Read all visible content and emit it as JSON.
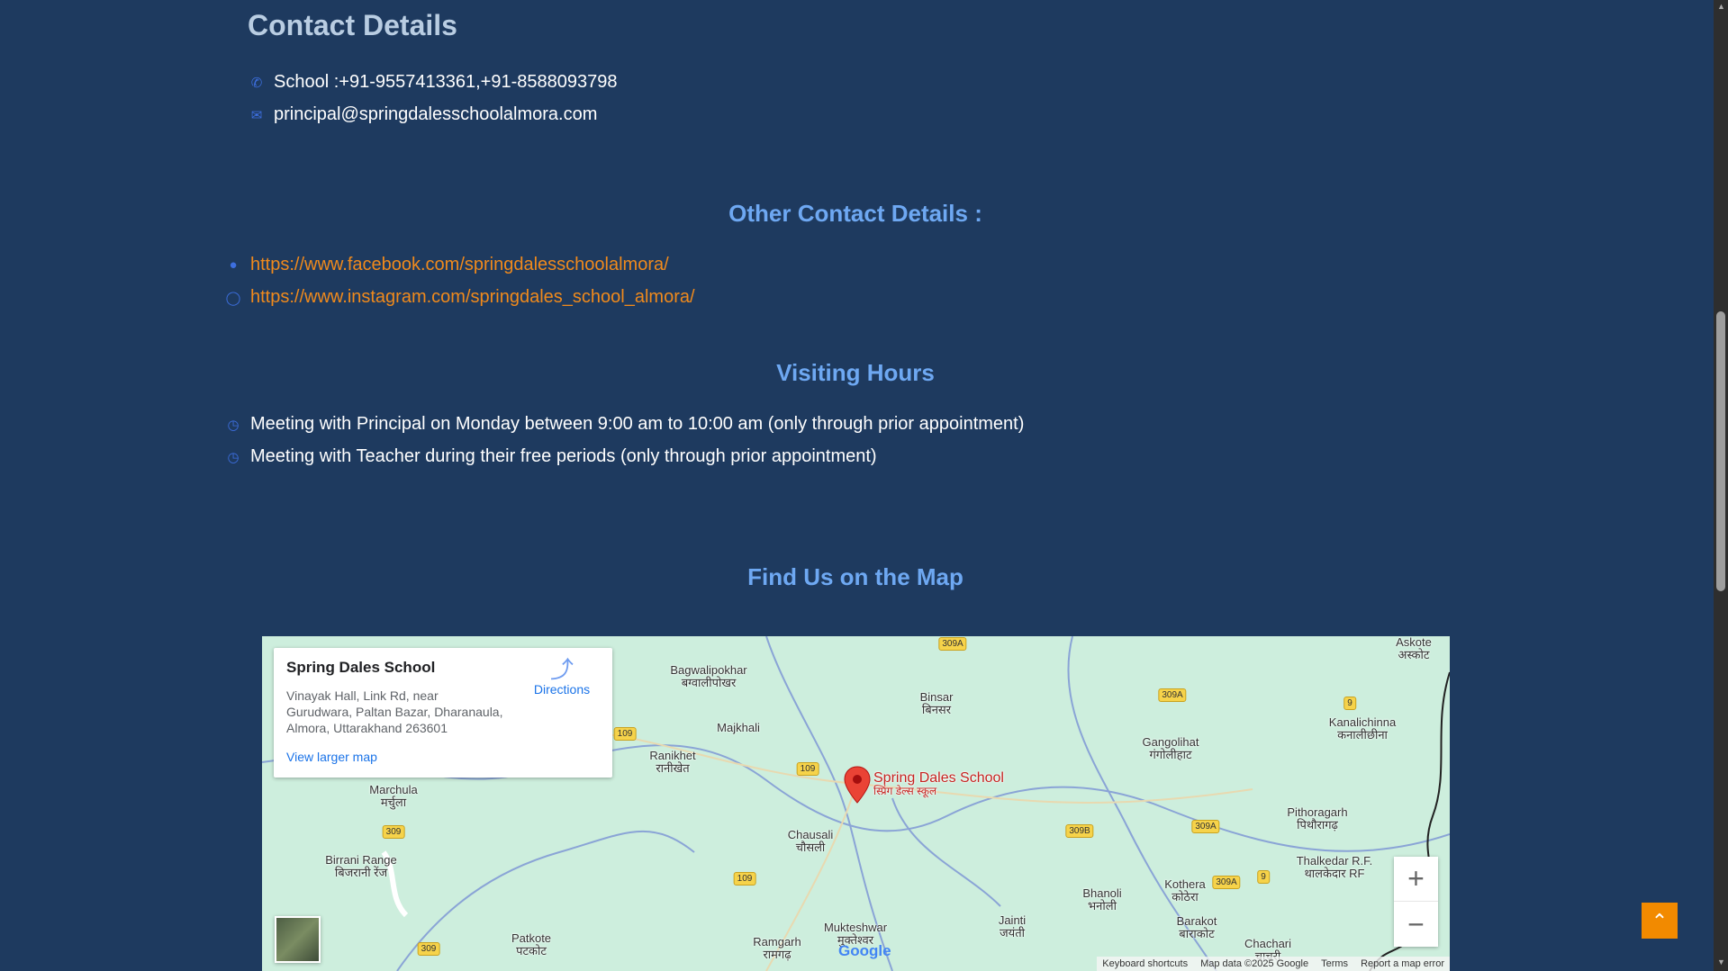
{
  "contact": {
    "title": "Contact Details",
    "phone": "School :+91-9557413361,+91-8588093798",
    "email": "principal@springdalesschoolalmora.com"
  },
  "other": {
    "title": "Other Contact Details :",
    "facebook": "https://www.facebook.com/springdalesschoolalmora/",
    "instagram": "https://www.instagram.com/springdales_school_almora/"
  },
  "visiting": {
    "title": "Visiting Hours",
    "items": [
      "Meeting with Principal on Monday between 9:00 am to 10:00 am (only through prior appointment)",
      "Meeting with Teacher during their free periods (only through prior appointment)"
    ]
  },
  "map": {
    "title": "Find Us on the Map",
    "place_name": "Spring Dales School",
    "address_lines": [
      "Vinayak Hall, Link Rd, near",
      "Gurudwara, Paltan Bazar, Dharanaula,",
      "Almora, Uttarakhand 263601"
    ],
    "directions": "Directions",
    "view_larger": "View larger map",
    "marker_label": "Spring Dales School",
    "marker_label_hi": "स्प्रिंग डेल्स स्कूल",
    "zoom_in": "+",
    "zoom_out": "−",
    "google": "Google",
    "attribution": [
      "Keyboard shortcuts",
      "Map data ©2025 Google",
      "Terms",
      "Report a map error"
    ],
    "places": [
      [
        "Bagwalipokhar",
        "बग्वालीपोखर"
      ],
      [
        "Binsar",
        "बिनसर"
      ],
      [
        "Majkhali",
        ""
      ],
      [
        "Ranikhet",
        "रानीखेत"
      ],
      [
        "Gangolihat",
        "गंगोलीहाट"
      ],
      [
        "Kanalichinna",
        "कनालीछीना"
      ],
      [
        "Marchula",
        "मर्चुला"
      ],
      [
        "Chausali",
        "चौसली"
      ],
      [
        "Pithoragarh",
        "पिथौरागढ़"
      ],
      [
        "Birrani Range",
        "बिजरानी रेंज"
      ],
      [
        "Thalkedar R.F.",
        "थालकेदार RF"
      ],
      [
        "Bhanoli",
        "भनोली"
      ],
      [
        "Kothera",
        "कोठेरा"
      ],
      [
        "Barakot",
        "बाराकोट"
      ],
      [
        "Jainti",
        "जयंती"
      ],
      [
        "Mukteshwar",
        "मुक्तेश्वर"
      ],
      [
        "Ramgarh",
        "रामगढ़"
      ],
      [
        "Patkote",
        "पटकोट"
      ],
      [
        "Chachari",
        "चाचरी"
      ],
      [
        "Askote",
        "अस्कोट"
      ]
    ],
    "roads": [
      "309A",
      "109",
      "109",
      "309A",
      "9",
      "309",
      "309B",
      "309A",
      "309A",
      "9",
      "109",
      "309"
    ]
  },
  "colors": {
    "background": "#1e3a5f",
    "heading": "#6ea8f2",
    "link": "#f08a1c",
    "accent": "#f28a00"
  }
}
